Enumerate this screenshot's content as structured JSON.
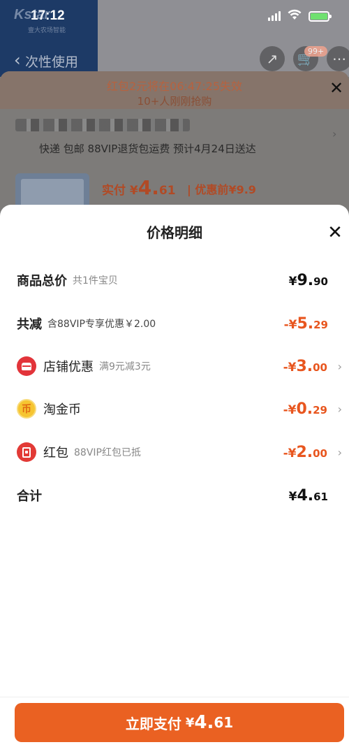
{
  "status_bar": {
    "time": "17:12"
  },
  "background_page": {
    "logo_sub": "壹大农场智能",
    "nav_title": "次性使用",
    "cart_badge": "99+",
    "promo_line1": "红包2元将在06:47:25失效",
    "promo_line2": "10+人刚刚抢购",
    "shipping": "快递 包邮 88VIP退货包运费 预计4月24日送达",
    "paid_label": "实付",
    "paid_yen": "¥",
    "paid_int": "4.",
    "paid_dec": "61",
    "pre_label": "优惠前",
    "pre_price": "¥9.9"
  },
  "sheet": {
    "title": "价格明细",
    "rows": [
      {
        "label": "商品总价",
        "sub": "共1件宝贝",
        "yen": "¥",
        "int": "9.",
        "dec": "90"
      },
      {
        "label": "共减",
        "sub": "含88VIP专享优惠￥2.00",
        "yen": "-¥",
        "int": "5.",
        "dec": "29"
      },
      {
        "label": "店铺优惠",
        "sub": "满9元减3元",
        "yen": "-¥",
        "int": "3.",
        "dec": "00",
        "icon": "store-icon"
      },
      {
        "label": "淘金币",
        "sub": "",
        "yen": "-¥",
        "int": "0.",
        "dec": "29",
        "icon": "coin-icon",
        "icon_glyph": "币"
      },
      {
        "label": "红包",
        "sub": "88VIP红包已抵",
        "yen": "-¥",
        "int": "2.",
        "dec": "00",
        "icon": "red-packet-icon"
      },
      {
        "label": "合计",
        "sub": "",
        "yen": "¥",
        "int": "4.",
        "dec": "61"
      }
    ]
  },
  "pay_button": {
    "label": "立即支付",
    "yen": "¥",
    "int": "4.",
    "dec": "61"
  },
  "colors": {
    "accent": "#ea6122",
    "discount": "#e8561f",
    "store_icon": "#e2343a",
    "coin_icon": "#f6c531"
  }
}
